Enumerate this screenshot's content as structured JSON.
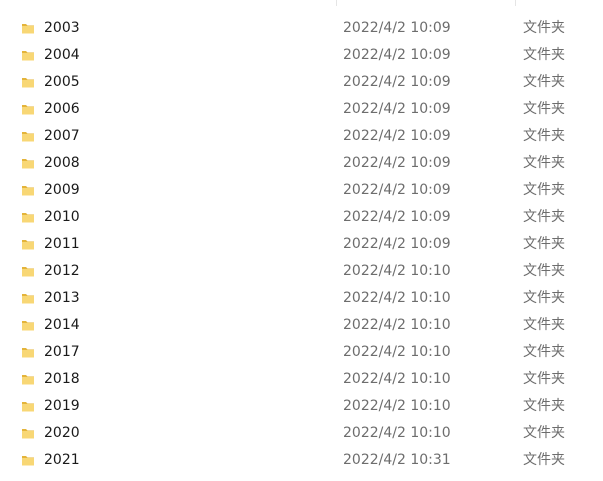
{
  "icons": {
    "folder": "folder-icon",
    "folder_color_main": "#f8d775",
    "folder_color_dark": "#e4b43a"
  },
  "files": [
    {
      "name": "2003",
      "modified": "2022/4/2 10:09",
      "type": "文件夹"
    },
    {
      "name": "2004",
      "modified": "2022/4/2 10:09",
      "type": "文件夹"
    },
    {
      "name": "2005",
      "modified": "2022/4/2 10:09",
      "type": "文件夹"
    },
    {
      "name": "2006",
      "modified": "2022/4/2 10:09",
      "type": "文件夹"
    },
    {
      "name": "2007",
      "modified": "2022/4/2 10:09",
      "type": "文件夹"
    },
    {
      "name": "2008",
      "modified": "2022/4/2 10:09",
      "type": "文件夹"
    },
    {
      "name": "2009",
      "modified": "2022/4/2 10:09",
      "type": "文件夹"
    },
    {
      "name": "2010",
      "modified": "2022/4/2 10:09",
      "type": "文件夹"
    },
    {
      "name": "2011",
      "modified": "2022/4/2 10:09",
      "type": "文件夹"
    },
    {
      "name": "2012",
      "modified": "2022/4/2 10:10",
      "type": "文件夹"
    },
    {
      "name": "2013",
      "modified": "2022/4/2 10:10",
      "type": "文件夹"
    },
    {
      "name": "2014",
      "modified": "2022/4/2 10:10",
      "type": "文件夹"
    },
    {
      "name": "2017",
      "modified": "2022/4/2 10:10",
      "type": "文件夹"
    },
    {
      "name": "2018",
      "modified": "2022/4/2 10:10",
      "type": "文件夹"
    },
    {
      "name": "2019",
      "modified": "2022/4/2 10:10",
      "type": "文件夹"
    },
    {
      "name": "2020",
      "modified": "2022/4/2 10:10",
      "type": "文件夹"
    },
    {
      "name": "2021",
      "modified": "2022/4/2 10:31",
      "type": "文件夹"
    }
  ]
}
